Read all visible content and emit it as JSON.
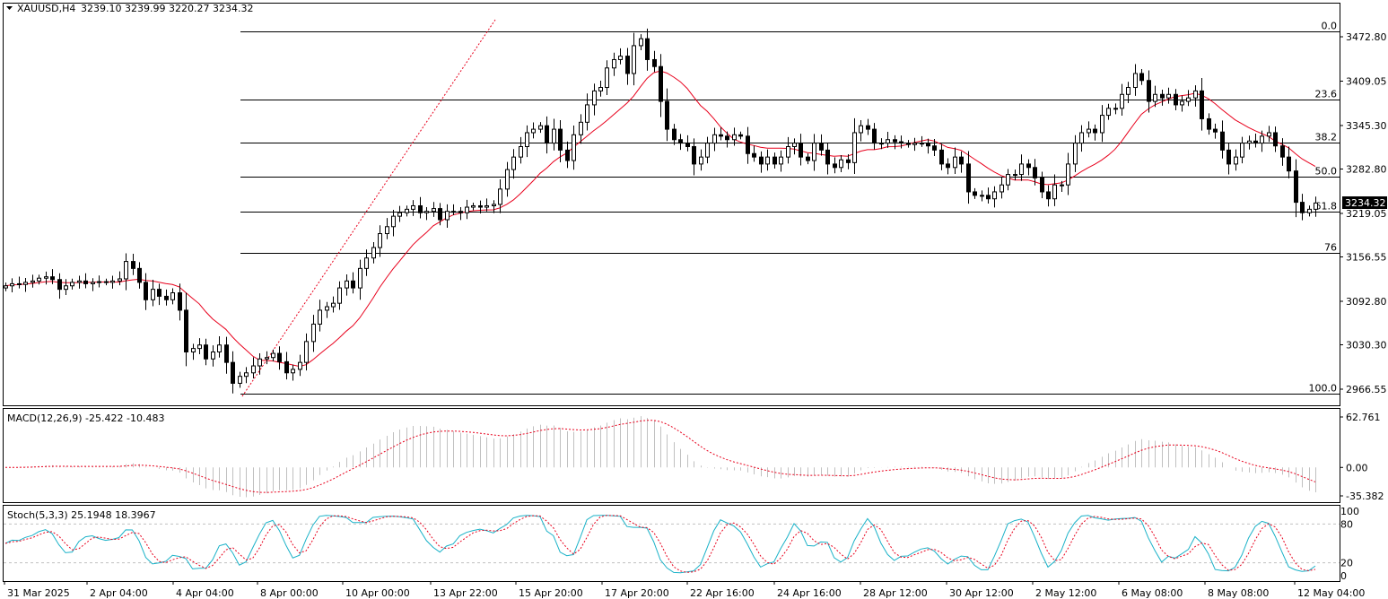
{
  "header": {
    "symbol": "XAUUSD,H4",
    "ohlc": "3239.10 3239.99 3220.27 3234.32",
    "menu_icon": "triangle-down-icon"
  },
  "colors": {
    "background": "#ffffff",
    "frame": "#000000",
    "ma": "#e8001c",
    "bull_body": "#ffffff",
    "bear_body": "#000000",
    "macd_hist": "#c0c0c0",
    "macd_signal": "#e8001c",
    "stoch_main": "#1ab2c8",
    "stoch_signal": "#e8001c",
    "level_line": "#c0c0c0",
    "price_tag_bg": "#000000",
    "price_tag_text": "#ffffff"
  },
  "chart_data": {
    "type": "candlestick",
    "title": "XAUUSD,H4",
    "current_price": "3234.32",
    "y_ticks": [
      3472.8,
      3409.05,
      3345.3,
      3282.8,
      3219.05,
      3156.55,
      3092.8,
      3030.3,
      2966.55
    ],
    "y_tick_labels": [
      "3472.80",
      "3409.05",
      "3345.30",
      "3282.80",
      "3219.05",
      "3156.55",
      "3092.80",
      "3030.30",
      "2966.55"
    ],
    "x_tick_labels": [
      "31 Mar 2025",
      "2 Apr 04:00",
      "4 Apr 04:00",
      "8 Apr 00:00",
      "10 Apr 00:00",
      "13 Apr 22:00",
      "15 Apr 20:00",
      "17 Apr 20:00",
      "22 Apr 16:00",
      "24 Apr 16:00",
      "28 Apr 12:00",
      "30 Apr 12:00",
      "2 May 12:00",
      "6 May 08:00",
      "8 May 08:00",
      "12 May 04:00"
    ],
    "fibonacci": {
      "levels": [
        {
          "label": "0.0",
          "price": 3481.0
        },
        {
          "label": "23.6",
          "price": 3382.0
        },
        {
          "label": "38.2",
          "price": 3321.0
        },
        {
          "label": "50.0",
          "price": 3271.5
        },
        {
          "label": "61.8",
          "price": 3222.0
        },
        {
          "label": "76",
          "price": 3162.5
        },
        {
          "label": "100.0",
          "price": 2960.0
        }
      ]
    },
    "close_series": [
      3115,
      3118,
      3117,
      3120,
      3122,
      3126,
      3128,
      3124,
      3110,
      3115,
      3120,
      3122,
      3118,
      3120,
      3121,
      3120,
      3122,
      3125,
      3150,
      3140,
      3120,
      3095,
      3110,
      3100,
      3095,
      3105,
      3080,
      3020,
      3025,
      3030,
      3010,
      3020,
      3030,
      3005,
      2975,
      2985,
      2990,
      3000,
      3010,
      3012,
      3018,
      3006,
      2990,
      2995,
      3005,
      3035,
      3060,
      3080,
      3085,
      3090,
      3112,
      3122,
      3112,
      3140,
      3155,
      3170,
      3190,
      3200,
      3215,
      3220,
      3225,
      3230,
      3220,
      3222,
      3226,
      3210,
      3222,
      3222,
      3220,
      3228,
      3230,
      3228,
      3230,
      3232,
      3254,
      3282,
      3300,
      3315,
      3335,
      3340,
      3345,
      3320,
      3340,
      3310,
      3295,
      3332,
      3350,
      3375,
      3395,
      3400,
      3428,
      3440,
      3445,
      3420,
      3460,
      3470,
      3440,
      3430,
      3380,
      3340,
      3325,
      3320,
      3315,
      3290,
      3300,
      3320,
      3332,
      3330,
      3325,
      3332,
      3330,
      3305,
      3300,
      3290,
      3300,
      3290,
      3300,
      3315,
      3320,
      3300,
      3295,
      3320,
      3310,
      3290,
      3285,
      3296,
      3292,
      3335,
      3345,
      3340,
      3320,
      3320,
      3325,
      3322,
      3320,
      3318,
      3320,
      3320,
      3316,
      3310,
      3290,
      3285,
      3300,
      3290,
      3250,
      3245,
      3245,
      3240,
      3250,
      3260,
      3275,
      3275,
      3290,
      3285,
      3270,
      3250,
      3240,
      3260,
      3260,
      3290,
      3320,
      3335,
      3340,
      3335,
      3360,
      3370,
      3370,
      3390,
      3400,
      3420,
      3410,
      3380,
      3390,
      3385,
      3390,
      3375,
      3380,
      3385,
      3395,
      3355,
      3340,
      3336,
      3310,
      3290,
      3300,
      3320,
      3323,
      3320,
      3330,
      3335,
      3316,
      3300,
      3280,
      3235,
      3220,
      3225,
      3234
    ],
    "ma_period_note": "",
    "macd": {
      "label": "MACD(12,26,9) -25.422 -10.483",
      "y_tick_labels": [
        "62.761",
        "0.00",
        "-35.382"
      ],
      "max": 62.761,
      "min": -35.382
    },
    "stochastic": {
      "label": "Stoch(5,3,3) 25.1948 18.3967",
      "y_tick_labels": [
        "100",
        "80",
        "20",
        "0"
      ],
      "levels": [
        80,
        20
      ]
    }
  }
}
